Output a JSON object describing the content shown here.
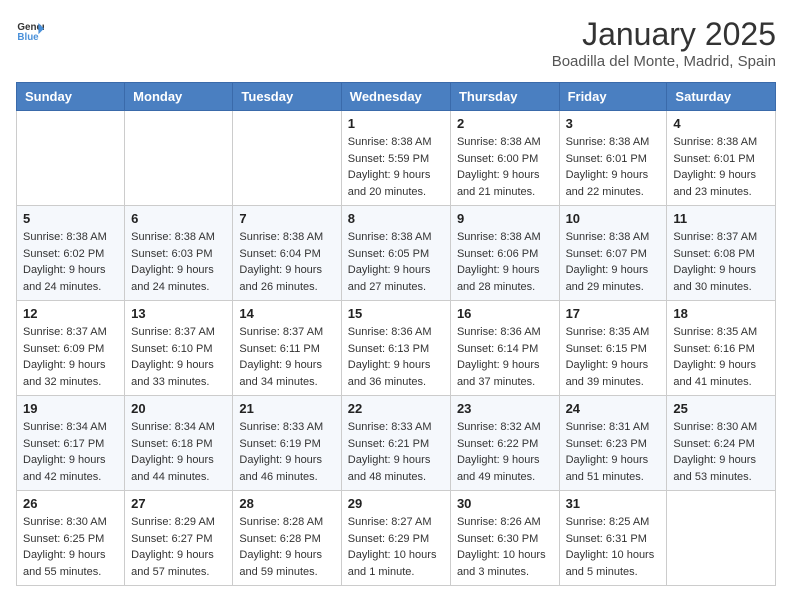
{
  "header": {
    "logo_general": "General",
    "logo_blue": "Blue",
    "month": "January 2025",
    "location": "Boadilla del Monte, Madrid, Spain"
  },
  "weekdays": [
    "Sunday",
    "Monday",
    "Tuesday",
    "Wednesday",
    "Thursday",
    "Friday",
    "Saturday"
  ],
  "weeks": [
    [
      {
        "day": "",
        "info": ""
      },
      {
        "day": "",
        "info": ""
      },
      {
        "day": "",
        "info": ""
      },
      {
        "day": "1",
        "info": "Sunrise: 8:38 AM\nSunset: 5:59 PM\nDaylight: 9 hours\nand 20 minutes."
      },
      {
        "day": "2",
        "info": "Sunrise: 8:38 AM\nSunset: 6:00 PM\nDaylight: 9 hours\nand 21 minutes."
      },
      {
        "day": "3",
        "info": "Sunrise: 8:38 AM\nSunset: 6:01 PM\nDaylight: 9 hours\nand 22 minutes."
      },
      {
        "day": "4",
        "info": "Sunrise: 8:38 AM\nSunset: 6:01 PM\nDaylight: 9 hours\nand 23 minutes."
      }
    ],
    [
      {
        "day": "5",
        "info": "Sunrise: 8:38 AM\nSunset: 6:02 PM\nDaylight: 9 hours\nand 24 minutes."
      },
      {
        "day": "6",
        "info": "Sunrise: 8:38 AM\nSunset: 6:03 PM\nDaylight: 9 hours\nand 24 minutes."
      },
      {
        "day": "7",
        "info": "Sunrise: 8:38 AM\nSunset: 6:04 PM\nDaylight: 9 hours\nand 26 minutes."
      },
      {
        "day": "8",
        "info": "Sunrise: 8:38 AM\nSunset: 6:05 PM\nDaylight: 9 hours\nand 27 minutes."
      },
      {
        "day": "9",
        "info": "Sunrise: 8:38 AM\nSunset: 6:06 PM\nDaylight: 9 hours\nand 28 minutes."
      },
      {
        "day": "10",
        "info": "Sunrise: 8:38 AM\nSunset: 6:07 PM\nDaylight: 9 hours\nand 29 minutes."
      },
      {
        "day": "11",
        "info": "Sunrise: 8:37 AM\nSunset: 6:08 PM\nDaylight: 9 hours\nand 30 minutes."
      }
    ],
    [
      {
        "day": "12",
        "info": "Sunrise: 8:37 AM\nSunset: 6:09 PM\nDaylight: 9 hours\nand 32 minutes."
      },
      {
        "day": "13",
        "info": "Sunrise: 8:37 AM\nSunset: 6:10 PM\nDaylight: 9 hours\nand 33 minutes."
      },
      {
        "day": "14",
        "info": "Sunrise: 8:37 AM\nSunset: 6:11 PM\nDaylight: 9 hours\nand 34 minutes."
      },
      {
        "day": "15",
        "info": "Sunrise: 8:36 AM\nSunset: 6:13 PM\nDaylight: 9 hours\nand 36 minutes."
      },
      {
        "day": "16",
        "info": "Sunrise: 8:36 AM\nSunset: 6:14 PM\nDaylight: 9 hours\nand 37 minutes."
      },
      {
        "day": "17",
        "info": "Sunrise: 8:35 AM\nSunset: 6:15 PM\nDaylight: 9 hours\nand 39 minutes."
      },
      {
        "day": "18",
        "info": "Sunrise: 8:35 AM\nSunset: 6:16 PM\nDaylight: 9 hours\nand 41 minutes."
      }
    ],
    [
      {
        "day": "19",
        "info": "Sunrise: 8:34 AM\nSunset: 6:17 PM\nDaylight: 9 hours\nand 42 minutes."
      },
      {
        "day": "20",
        "info": "Sunrise: 8:34 AM\nSunset: 6:18 PM\nDaylight: 9 hours\nand 44 minutes."
      },
      {
        "day": "21",
        "info": "Sunrise: 8:33 AM\nSunset: 6:19 PM\nDaylight: 9 hours\nand 46 minutes."
      },
      {
        "day": "22",
        "info": "Sunrise: 8:33 AM\nSunset: 6:21 PM\nDaylight: 9 hours\nand 48 minutes."
      },
      {
        "day": "23",
        "info": "Sunrise: 8:32 AM\nSunset: 6:22 PM\nDaylight: 9 hours\nand 49 minutes."
      },
      {
        "day": "24",
        "info": "Sunrise: 8:31 AM\nSunset: 6:23 PM\nDaylight: 9 hours\nand 51 minutes."
      },
      {
        "day": "25",
        "info": "Sunrise: 8:30 AM\nSunset: 6:24 PM\nDaylight: 9 hours\nand 53 minutes."
      }
    ],
    [
      {
        "day": "26",
        "info": "Sunrise: 8:30 AM\nSunset: 6:25 PM\nDaylight: 9 hours\nand 55 minutes."
      },
      {
        "day": "27",
        "info": "Sunrise: 8:29 AM\nSunset: 6:27 PM\nDaylight: 9 hours\nand 57 minutes."
      },
      {
        "day": "28",
        "info": "Sunrise: 8:28 AM\nSunset: 6:28 PM\nDaylight: 9 hours\nand 59 minutes."
      },
      {
        "day": "29",
        "info": "Sunrise: 8:27 AM\nSunset: 6:29 PM\nDaylight: 10 hours\nand 1 minute."
      },
      {
        "day": "30",
        "info": "Sunrise: 8:26 AM\nSunset: 6:30 PM\nDaylight: 10 hours\nand 3 minutes."
      },
      {
        "day": "31",
        "info": "Sunrise: 8:25 AM\nSunset: 6:31 PM\nDaylight: 10 hours\nand 5 minutes."
      },
      {
        "day": "",
        "info": ""
      }
    ]
  ]
}
